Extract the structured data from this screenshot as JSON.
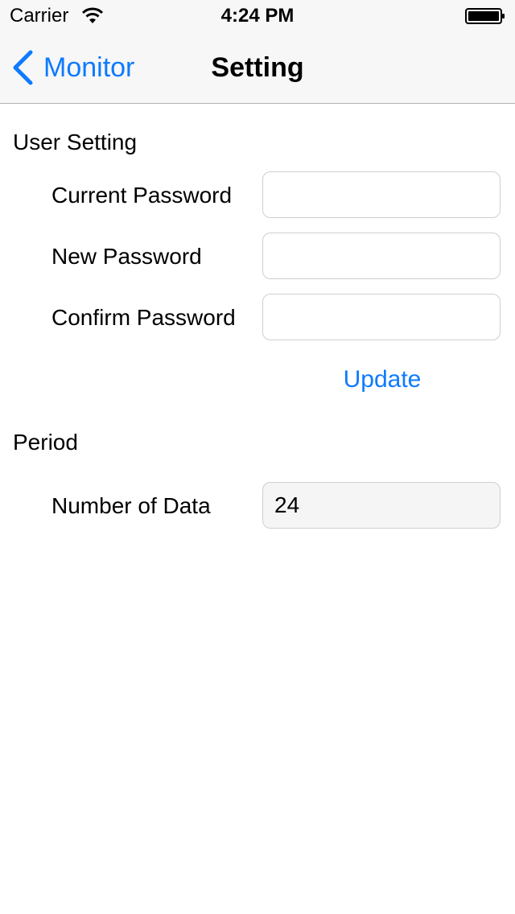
{
  "status_bar": {
    "carrier": "Carrier",
    "time": "4:24 PM",
    "icons": [
      "wifi-icon",
      "battery-icon"
    ]
  },
  "nav": {
    "back_label": "Monitor",
    "title": "Setting",
    "back_icon": "chevron-left-icon"
  },
  "user_setting": {
    "title": "User Setting",
    "fields": [
      {
        "label": "Current Password",
        "value": ""
      },
      {
        "label": "New Password",
        "value": ""
      },
      {
        "label": "Confirm Password",
        "value": ""
      }
    ],
    "update_label": "Update"
  },
  "period": {
    "title": "Period",
    "number_of_data_label": "Number of Data",
    "number_of_data_value": "24"
  },
  "colors": {
    "accent": "#0e7afe",
    "bar_background": "#f7f7f7",
    "field_border": "#cfcfcf"
  }
}
